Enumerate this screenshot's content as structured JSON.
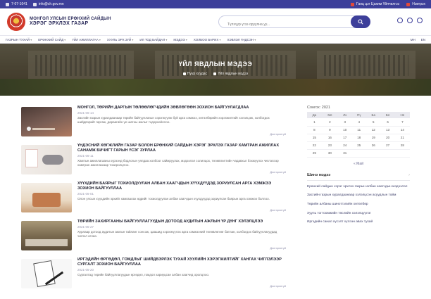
{
  "topbar": {
    "phone": "7-07-1041",
    "email": "info@ch.gov.mn",
    "right_links": [
      "Ганц цэг Цахим Үйлчилгээ",
      "Нэвтрэх"
    ]
  },
  "header": {
    "brand_line1": "МОНГОЛ УЛСЫН ЕРӨНХИЙ САЙДЫН",
    "brand_line2": "ХЭРЭГ ЭРХЛЭХ ГАЗАР",
    "search_placeholder": "Түлхүүр үгээ оруулна уу..."
  },
  "nav": {
    "items": [
      "ГАЗРЫН ТУХАЙ",
      "ЕРӨНХИЙ САЙД",
      "ҮЙЛ АЖИЛЛАГАА",
      "ХУУЛЬ ЭРХ ЗҮЙ",
      "ИЛ ТОД БАЙДАЛ",
      "МЭДЭЭ",
      "ХОЛБОО БАРИХ",
      "ХЭВЛЭЛ ҮНДСЭН"
    ],
    "right": [
      "МН",
      "EN"
    ]
  },
  "hero": {
    "title": "ҮЙЛ ЯВДЛЫН МЭДЭЭ",
    "crumbs": [
      "Нүүр хуудас",
      "Үйл явдлын мэдээ"
    ]
  },
  "news": [
    {
      "title": "МОНГОЛ, ТӨРИЙН ДАРГЫН ТӨЛӨӨЛӨГЧДИЙН ЗӨВЛӨГӨӨН ЗОХИОН БАЙГУУЛАГДЛАА",
      "date": "2021-06-14",
      "text": "Засгийн газрын хуралдаанаар төрийн байгууллагын хэрэгжүүлж буй арга хэмжээ, хөтөлбөрийн хэрэгжилтийг хэлэлцэж, холбогдох шийдвэрийг гаргаж, дараагийн үе шатны ажлыг тодорхойллоо.",
      "more": "Дэлгэрэнгүй"
    },
    {
      "title": "ҮНДЭСНИЙ ХӨГЖЛИЙН ГАЗАР БОЛОН ЕРӨНХИЙ САЙДЫН ХЭРЭГ ЭРХЛЭХ ГАЗАР ХАМТРАН АЖИЛЛАХ САНАМЖ БИЧИГТ ГАРЫН ҮСЭГ ЗУРЛАА",
      "date": "2021-06-11",
      "text": "Хамтын ажиллагааны хүрээнд бодлогын уялдаа холбоог сайжруулах, мэдээлэл солилцох, төлөвлөлтийн чадавхыг бэхжүүлэх чиглэлээр хамтран ажиллахаар тохиролцлоо.",
      "more": "Дэлгэрэнгүй"
    },
    {
      "title": "ХҮҮХДИЙН БАЯРЫГ ТОХИОЛДУУЛАН АЛБАН ХААГЧДЫН ХҮҮХДҮҮДЭД ЗОРИУЛСАН АРГА ХЭМЖЭЭ ЗОХИОН БАЙГУУЛЛАА",
      "date": "2021-06-01",
      "text": "Олон улсын хүүхдийн эрхийг хамгаалах өдрийг тохиолдуулан албан хаагчдын хүүхдүүдэд зориулсан баярын арга хэмжээ боллоо.",
      "more": "Дэлгэрэнгүй"
    },
    {
      "title": "ТӨРИЙН ЗАХИРГААНЫ БАЙГУУЛЛАГУУДЫН ДОТООД АУДИТЫН АЖЛЫН ҮР ДҮНГ ХЭЛЭЛЦЛЭЭ",
      "date": "2021-05-27",
      "text": "Хурлаар дотоод аудитын ажлын тайланг сонсож, цаашид хэрэгжүүлэх арга хэмжээний төлөвлөгөөг батлан, холбогдох байгууллагуудад чиглэл өглөө.",
      "more": "Дэлгэрэнгүй"
    },
    {
      "title": "ИРГЭДИЙН ӨРГӨДӨЛ, ГОМДЛЫГ ШИЙДВЭРЛЭХ ТУХАЙ ХУУЛИЙН ХЭРЭГЖИЛТИЙГ ХАНГАХ ЧИГЛЭЛЭЭР СУРГАЛТ ЗОХИОН БАЙГУУЛЛАА",
      "date": "2021-05-20",
      "text": "Сургалтад төрийн байгууллагуудын өргөдөл, гомдол хариуцсан албан хаагчид оролцлоо.",
      "more": "Дэлгэрэнгүй"
    }
  ],
  "sidebar": {
    "calendar_title": "Сонгох: 2021",
    "days": [
      "Да",
      "Мя",
      "Лх",
      "Пү",
      "Ба",
      "Бя",
      "Ня"
    ],
    "weeks": [
      [
        "1",
        "2",
        "3",
        "4",
        "5",
        "6",
        "7"
      ],
      [
        "8",
        "9",
        "10",
        "11",
        "12",
        "13",
        "14"
      ],
      [
        "15",
        "16",
        "17",
        "18",
        "19",
        "20",
        "21"
      ],
      [
        "22",
        "23",
        "24",
        "25",
        "26",
        "27",
        "28"
      ],
      [
        "29",
        "30",
        "31",
        "",
        "",
        "",
        ""
      ]
    ],
    "cal_prev": "« Май",
    "section_title": "Шинэ мэдээ",
    "links": [
      "Ерөнхий сайдын хэрэг эрхлэх газрын албан хаагчдын мэдээлэл",
      "Засгийн газрын хуралдаанаар хэлэлцсэн асуудлын тойм",
      "Төрийн албаны шинэтгэлийн хөтөлбөр",
      "Хууль тогтоомжийн төслийн хэлэлцүүлэг",
      "Иргэдийн санал хүсэлт хүлээн авах тухай"
    ]
  }
}
